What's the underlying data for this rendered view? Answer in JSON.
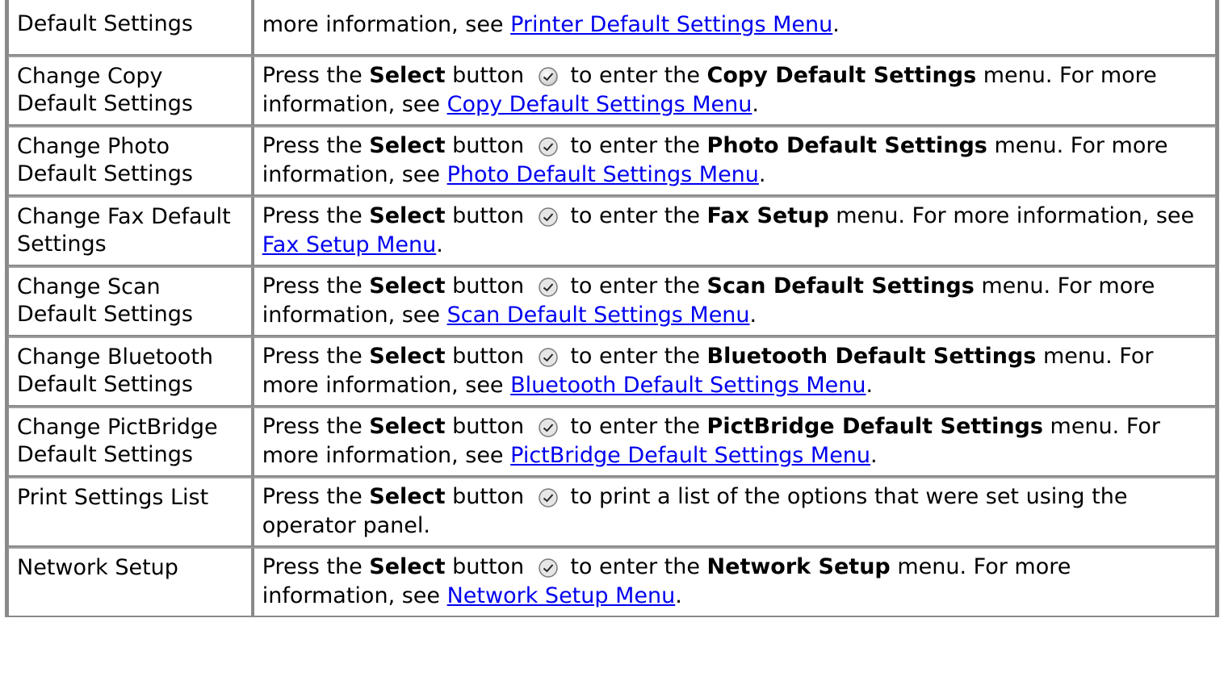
{
  "rows": [
    {
      "name": "Default Settings",
      "pre": "",
      "button": "",
      "mid": "",
      "menu": "",
      "info": "more information, see ",
      "link": "Printer Default Settings Menu",
      "tail": "."
    },
    {
      "name": "Change Copy Default Settings",
      "pre": "Press the ",
      "button": "Select",
      "mid": " button ",
      "action": " to enter the ",
      "menu": "Copy Default Settings",
      "info": " menu. For more information, see ",
      "link": "Copy Default Settings Menu",
      "tail": "."
    },
    {
      "name": "Change Photo Default Settings",
      "pre": "Press the ",
      "button": "Select",
      "mid": " button ",
      "action": " to enter the ",
      "menu": "Photo Default Settings",
      "info": " menu. For more information, see ",
      "link": "Photo Default Settings Menu",
      "tail": "."
    },
    {
      "name": "Change Fax Default Settings",
      "pre": "Press the ",
      "button": "Select",
      "mid": " button ",
      "action": " to enter the ",
      "menu": "Fax Setup",
      "info": " menu. For more information, see ",
      "link": "Fax Setup Menu",
      "tail": "."
    },
    {
      "name": "Change Scan Default Settings",
      "pre": "Press the ",
      "button": "Select",
      "mid": " button ",
      "action": " to enter the ",
      "menu": "Scan Default Settings",
      "info": " menu. For more information, see ",
      "link": "Scan Default Settings Menu",
      "tail": "."
    },
    {
      "name": "Change Bluetooth Default Settings",
      "pre": "Press the ",
      "button": "Select",
      "mid": " button ",
      "action": " to enter the ",
      "menu": "Bluetooth Default Settings",
      "info": " menu. For more information, see ",
      "link": "Bluetooth Default Settings Menu",
      "tail": "."
    },
    {
      "name": "Change PictBridge Default Settings",
      "pre": "Press the ",
      "button": "Select",
      "mid": " button ",
      "action": " to enter the ",
      "menu": "PictBridge Default Settings",
      "info": " menu. For more information, see ",
      "link": "PictBridge Default Settings Menu",
      "tail": "."
    },
    {
      "name": "Print Settings List",
      "pre": "Press the ",
      "button": "Select",
      "mid": " button ",
      "action": " to print a list of the options that were set using the operator panel.",
      "menu": "",
      "info": "",
      "link": "",
      "tail": ""
    },
    {
      "name": "Network Setup",
      "pre": "Press the ",
      "button": "Select",
      "mid": " button ",
      "action": " to enter the ",
      "menu": "Network Setup",
      "info": " menu. For more information, see ",
      "link": "Network Setup Menu",
      "tail": "."
    }
  ],
  "icons": {
    "select_button": "select-checkmark-icon"
  }
}
